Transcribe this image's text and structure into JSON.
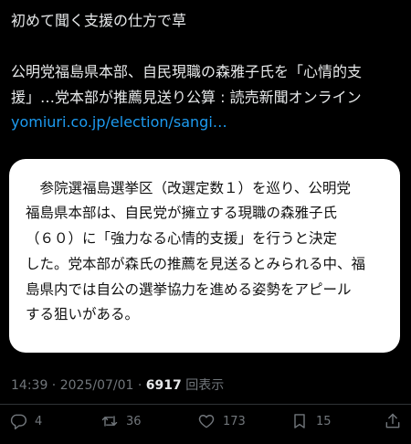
{
  "post": {
    "line1": "初めて聞く支援の仕方で草",
    "line2": "公明党福島県本部、自民現職の森雅子氏を「心情的支",
    "line3": "援」…党本部が推薦見送り公算 : 読売新聞オンライン",
    "link": "yomiuri.co.jp/election/sangi…"
  },
  "quote": {
    "lines": [
      "　参院選福島選挙区（改選定数１）を巡り、公明党",
      "福島県本部は、自民党が擁立する現職の森雅子氏",
      "（６０）に「強力なる心情的支援」を行うと決定",
      "した。党本部が森氏の推薦を見送るとみられる中、福",
      "島県内では自公の選挙協力を進める姿勢をアピール",
      "する狙いがある。"
    ]
  },
  "meta": {
    "time": "14:39",
    "separator": " · ",
    "date": "2025/07/01",
    "views_count": "6917",
    "views_label": " 回表示"
  },
  "actions": {
    "reply": {
      "icon": "reply-icon",
      "count": "4"
    },
    "repost": {
      "icon": "repost-icon",
      "count": "36"
    },
    "like": {
      "icon": "heart-icon",
      "count": "173"
    },
    "bookmark": {
      "icon": "bookmark-icon",
      "count": "15"
    },
    "share": {
      "icon": "share-icon"
    }
  },
  "colors": {
    "background": "#000000",
    "text": "#e7e9ea",
    "muted": "#71767b",
    "link": "#1d9bf0",
    "card": "#ffffff"
  }
}
